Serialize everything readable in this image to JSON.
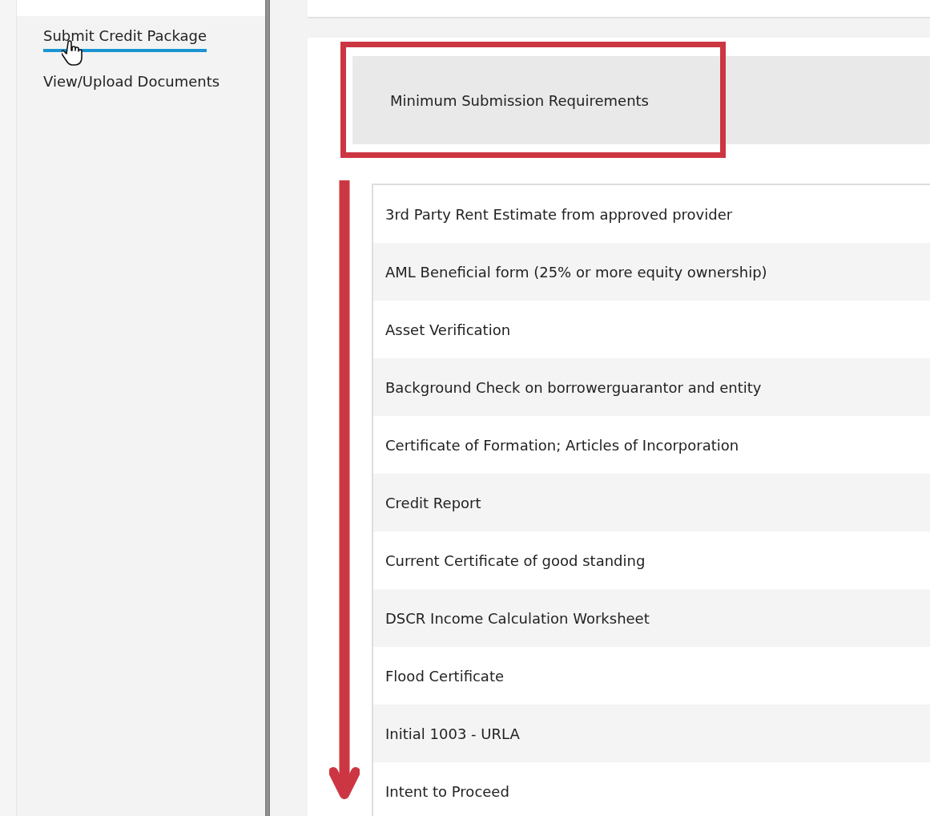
{
  "sidebar": {
    "items": [
      {
        "label": "Submit Credit Package",
        "selected": true
      },
      {
        "label": "View/Upload Documents",
        "selected": false
      }
    ]
  },
  "section": {
    "title": "Minimum Submission Requirements"
  },
  "requirements": [
    {
      "label": "3rd Party Rent Estimate from approved provider"
    },
    {
      "label": "AML Beneficial form (25% or more equity ownership)"
    },
    {
      "label": "Asset Verification"
    },
    {
      "label": "Background Check on borrowerguarantor and entity"
    },
    {
      "label": "Certificate of Formation; Articles of Incorporation"
    },
    {
      "label": "Credit Report"
    },
    {
      "label": "Current Certificate of good standing"
    },
    {
      "label": "DSCR Income Calculation Worksheet"
    },
    {
      "label": "Flood Certificate"
    },
    {
      "label": "Initial 1003 - URLA"
    },
    {
      "label": "Intent to Proceed"
    }
  ]
}
